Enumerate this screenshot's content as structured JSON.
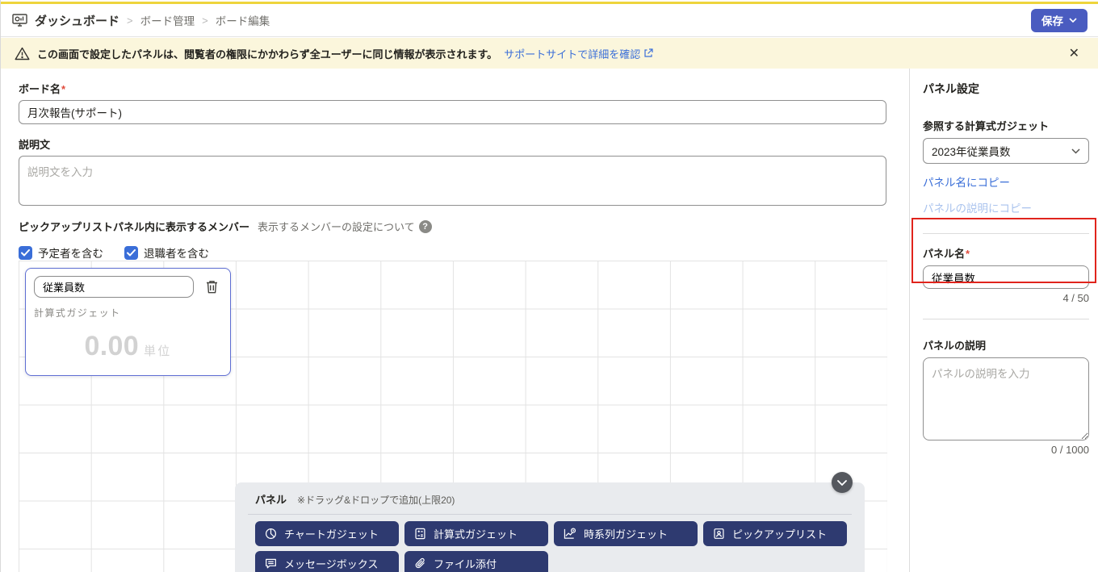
{
  "header": {
    "breadcrumb": [
      "ダッシュボード",
      "ボード管理",
      "ボード編集"
    ],
    "separator": ">",
    "save_button": "保存"
  },
  "banner": {
    "message": "この画面で設定したパネルは、閲覧者の権限にかかわらず全ユーザーに同じ情報が表示されます。",
    "link": "サポートサイトで詳細を確認",
    "close_icon": "✕"
  },
  "form": {
    "board_name": {
      "label": "ボード名",
      "required": "*",
      "value": "月次報告(サポート)"
    },
    "description": {
      "label": "説明文",
      "placeholder": "説明文を入力"
    },
    "members": {
      "label": "ピックアップリストパネル内に表示するメンバー",
      "help_text": "表示するメンバーの設定について",
      "help_icon": "?",
      "checkboxes": [
        {
          "label": "予定者を含む",
          "checked": true
        },
        {
          "label": "退職者を含む",
          "checked": true
        }
      ]
    }
  },
  "canvas": {
    "panel_card": {
      "name_value": "従業員数",
      "type_label": "計算式ガジェット",
      "value": "0.00",
      "unit": "単位",
      "trash_icon": "trash-icon"
    }
  },
  "palette": {
    "title": "パネル",
    "note": "※ドラッグ&ドロップで追加(上限20)",
    "buttons": [
      {
        "label": "チャートガジェット",
        "icon": "pie-chart-icon"
      },
      {
        "label": "計算式ガジェット",
        "icon": "calculator-icon"
      },
      {
        "label": "時系列ガジェット",
        "icon": "time-series-icon"
      },
      {
        "label": "ピックアップリスト",
        "icon": "pickup-list-icon"
      },
      {
        "label": "メッセージボックス",
        "icon": "message-box-icon"
      },
      {
        "label": "ファイル添付",
        "icon": "paperclip-icon"
      }
    ]
  },
  "sidebar": {
    "title": "パネル設定",
    "gadget_select": {
      "label": "参照する計算式ガジェット",
      "value": "2023年従業員数"
    },
    "copy_links": [
      {
        "label": "パネル名にコピー",
        "enabled": true
      },
      {
        "label": "パネルの説明にコピー",
        "enabled": false
      }
    ],
    "panel_name": {
      "label": "パネル名",
      "required": "*",
      "value": "従業員数",
      "counter": "4 / 50"
    },
    "panel_desc": {
      "label": "パネルの説明",
      "placeholder": "パネルの説明を入力",
      "counter": "0 / 1000"
    }
  },
  "colors": {
    "top_strip": "#eed53c",
    "save_button": "#4a5cc0",
    "banner_bg": "#fbf6dc",
    "link_blue": "#3b6fd8",
    "checkbox_blue": "#3a6ed8",
    "card_border_blue": "#5f6fd3",
    "palette_button_navy": "#2e3a70",
    "annotation_red": "#e0241c"
  }
}
